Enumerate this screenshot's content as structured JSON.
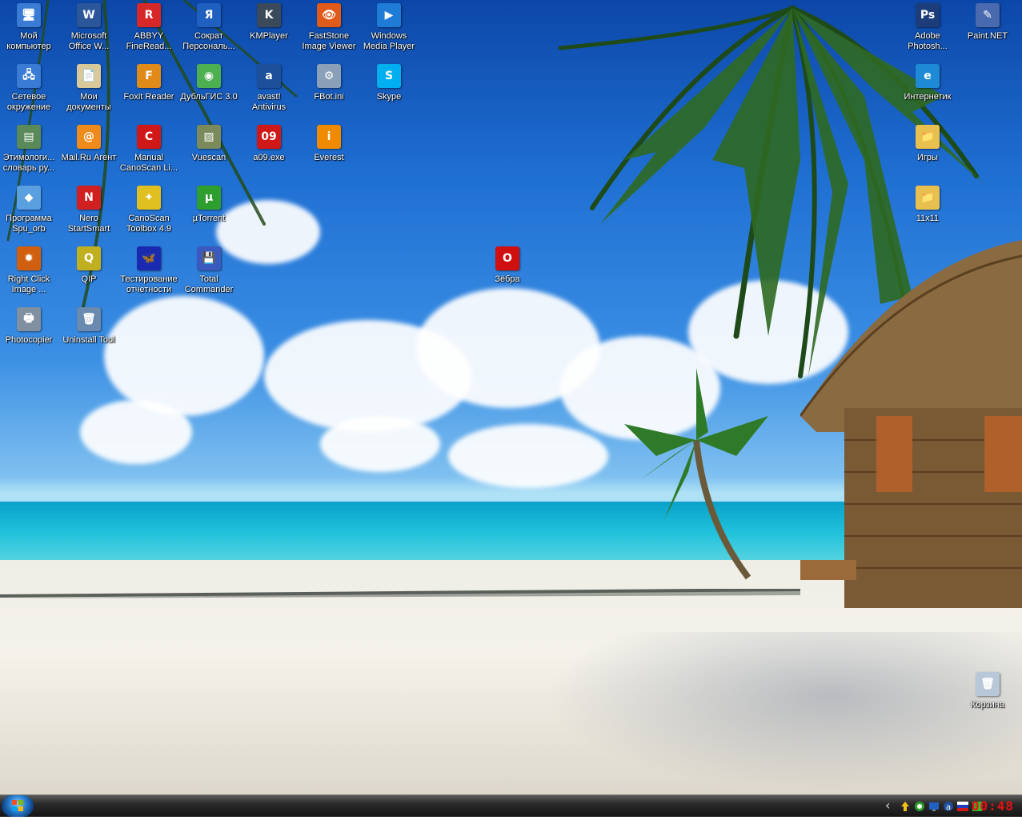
{
  "desktop": {
    "icons": [
      {
        "name": "my-computer-icon",
        "label": "Мой\nкомпьютер",
        "glyph": "🖥",
        "color": "#3a7bd5"
      },
      {
        "name": "ms-office-icon",
        "label": "Microsoft\nOffice W...",
        "glyph": "W",
        "color": "#2b579a"
      },
      {
        "name": "abbyy-icon",
        "label": "ABBYY\nFineRead...",
        "glyph": "R",
        "color": "#d62828"
      },
      {
        "name": "sokrat-icon",
        "label": "Сократ\nПерсональ...",
        "glyph": "Я",
        "color": "#1f5fbf"
      },
      {
        "name": "kmplayer-icon",
        "label": "KMPlayer",
        "glyph": "K",
        "color": "#3a4a5a"
      },
      {
        "name": "faststone-icon",
        "label": "FastStone\nImage Viewer",
        "glyph": "👁",
        "color": "#e05a1a"
      },
      {
        "name": "wmp-icon",
        "label": "Windows\nMedia Player",
        "glyph": "▶",
        "color": "#1e7bd6"
      },
      {
        "name": "network-icon",
        "label": "Сетевое\nокружение",
        "glyph": "🖧",
        "color": "#3a7bd5"
      },
      {
        "name": "my-documents-icon",
        "label": "Мои\nдокументы",
        "glyph": "📄",
        "color": "#d8c89a"
      },
      {
        "name": "foxit-icon",
        "label": "Foxit Reader",
        "glyph": "F",
        "color": "#e08a1a"
      },
      {
        "name": "dublgis-icon",
        "label": "ДубльГИС 3.0",
        "glyph": "◉",
        "color": "#4caf50"
      },
      {
        "name": "avast-icon",
        "label": "avast!\nAntivirus",
        "glyph": "a",
        "color": "#1e4f9a"
      },
      {
        "name": "fbot-icon",
        "label": "FBot.ini",
        "glyph": "⚙",
        "color": "#8aa0b8"
      },
      {
        "name": "skype-icon",
        "label": "Skype",
        "glyph": "S",
        "color": "#00aff0"
      },
      {
        "name": "etymology-icon",
        "label": "Этимологи...\nсловарь ру...",
        "glyph": "▤",
        "color": "#5a8a5a"
      },
      {
        "name": "mailru-icon",
        "label": "Mail.Ru Агент",
        "glyph": "@",
        "color": "#f08a1a"
      },
      {
        "name": "canoscan-manual-icon",
        "label": "Manual\nCanoScan Li...",
        "glyph": "C",
        "color": "#d01818"
      },
      {
        "name": "vuescan-icon",
        "label": "Vuescan",
        "glyph": "▨",
        "color": "#7a8a5a"
      },
      {
        "name": "a09-icon",
        "label": "a09.exe",
        "glyph": "09",
        "color": "#d01818"
      },
      {
        "name": "everest-icon",
        "label": "Everest",
        "glyph": "i",
        "color": "#f08a00"
      },
      {
        "name": "spu-orb-icon",
        "label": "Программа\nSpu_orb",
        "glyph": "◆",
        "color": "#5aa0e0"
      },
      {
        "name": "nero-icon",
        "label": "Nero\nStartSmart",
        "glyph": "N",
        "color": "#d02020"
      },
      {
        "name": "canoscan-toolbox-icon",
        "label": "CanoScan\nToolbox 4.9",
        "glyph": "✦",
        "color": "#e0c020"
      },
      {
        "name": "utorrent-icon",
        "label": "µTorrent",
        "glyph": "µ",
        "color": "#2e9e2e"
      },
      {
        "name": "rightclick-image-icon",
        "label": "Right Click\nImage ...",
        "glyph": "✹",
        "color": "#d06010"
      },
      {
        "name": "qip-icon",
        "label": "QIP",
        "glyph": "Q",
        "color": "#c0b020"
      },
      {
        "name": "testing-icon",
        "label": "Тестирование\nотчетности",
        "glyph": "🦋",
        "color": "#1a2ab0"
      },
      {
        "name": "total-commander-icon",
        "label": "Total\nCommander",
        "glyph": "💾",
        "color": "#3a5ac0"
      },
      {
        "name": "photocopier-icon",
        "label": "Photocopier",
        "glyph": "🖶",
        "color": "#8090a0"
      },
      {
        "name": "uninstall-tool-icon",
        "label": "Uninstall Tool",
        "glyph": "🗑",
        "color": "#6a8ab0"
      },
      {
        "name": "opera-icon",
        "label": "Зёбра",
        "glyph": "O",
        "color": "#d01010"
      },
      {
        "name": "photoshop-icon",
        "label": "Adobe\nPhotosh...",
        "glyph": "Ps",
        "color": "#1c3c7a"
      },
      {
        "name": "paintnet-icon",
        "label": "Paint.NET",
        "glyph": "✎",
        "color": "#4a6ab0"
      },
      {
        "name": "ie-icon",
        "label": "Интернетик",
        "glyph": "e",
        "color": "#1e8ad6"
      },
      {
        "name": "games-folder-icon",
        "label": "Игры",
        "glyph": "📁",
        "color": "#e8c050"
      },
      {
        "name": "folder-11x11-icon",
        "label": "11x11",
        "glyph": "📁",
        "color": "#e8c050"
      },
      {
        "name": "recycle-bin-icon",
        "label": "Корзина",
        "glyph": "🗑",
        "color": "#b8c8d8"
      }
    ]
  },
  "taskbar": {
    "clock": "00:48",
    "tray_arrow": "‹"
  }
}
